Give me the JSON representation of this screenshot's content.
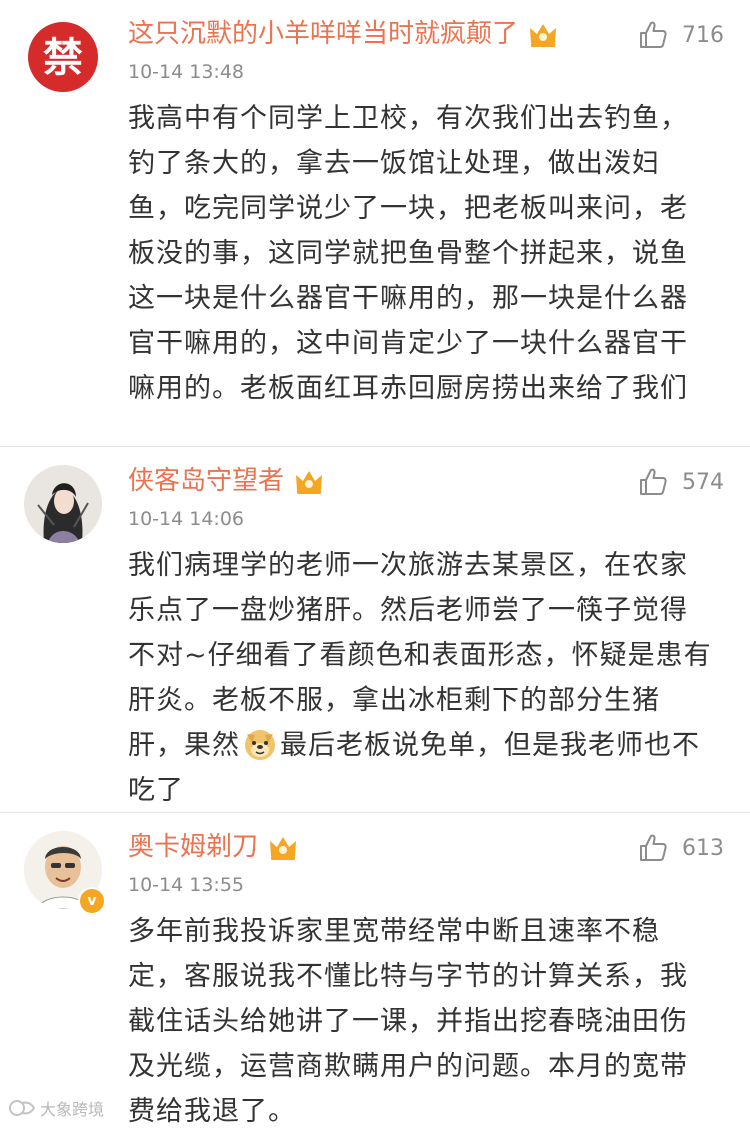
{
  "comments": [
    {
      "username": "这只沉默的小羊咩咩当时就疯颠了",
      "time": "10-14 13:48",
      "likes": "716",
      "avatar_text": "禁",
      "content": "我高中有个同学上卫校，有次我们出去钓鱼，钓了条大的，拿去一饭馆让处理，做出泼妇鱼，吃完同学说少了一块，把老板叫来问，老板没的事，这同学就把鱼骨整个拼起来，说鱼这一块是什么器官干嘛用的，那一块是什么器官干嘛用的，这中间肯定少了一块什么器官干嘛用的。老板面红耳赤回厨房捞出来给了我们"
    },
    {
      "username": "侠客岛守望者",
      "time": "10-14 14:06",
      "likes": "574",
      "content_before": "我们病理学的老师一次旅游去某景区，在农家乐点了一盘炒猪肝。然后老师尝了一筷子觉得不对~仔细看了看颜色和表面形态，怀疑是患有肝炎。老板不服，拿出冰柜剩下的部分生猪肝，果然",
      "content_after": "最后老板说免单，但是我老师也不吃了"
    },
    {
      "username": "奥卡姆剃刀",
      "time": "10-14 13:55",
      "likes": "613",
      "verified_badge": "v",
      "content": "多年前我投诉家里宽带经常中断且速率不稳定，客服说我不懂比特与字节的计算关系，我截住话头给她讲了一课，并指出挖春晓油田伤及光缆，运营商欺瞒用户的问题。本月的宽带费给我退了。"
    }
  ],
  "watermark": "大象跨境",
  "colors": {
    "username": "#eb7350",
    "meta": "#8c8c8c",
    "text": "#333333",
    "crown": "#f5a623",
    "divider": "#e6e6e6"
  }
}
